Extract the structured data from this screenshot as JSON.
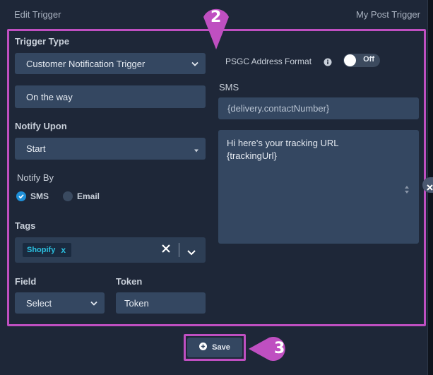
{
  "header": {
    "title": "Edit Trigger",
    "trigger_name": "My Post Trigger"
  },
  "left": {
    "trigger_type_label": "Trigger Type",
    "trigger_type_value": "Customer Notification Trigger",
    "status_value": "On the way",
    "notify_upon_label": "Notify Upon",
    "notify_upon_value": "Start",
    "notify_by_label": "Notify By",
    "notify_by_options": [
      {
        "label": "SMS",
        "selected": true
      },
      {
        "label": "Email",
        "selected": false
      }
    ],
    "tags_label": "Tags",
    "tags": [
      "Shopify"
    ],
    "tag_remove_glyph": "x",
    "tags_clear_glyph": "✕",
    "field_label": "Field",
    "field_value": "Select",
    "token_label": "Token",
    "token_value": "Token"
  },
  "right": {
    "psgc_label": "PSGC Address Format",
    "psgc_toggle": "Off",
    "sms_label": "SMS",
    "sms_recipient": "{delivery.contactNumber}",
    "sms_message_line1": "Hi here's your tracking URL",
    "sms_message_line2": "{trackingUrl}"
  },
  "footer": {
    "save_label": "Save"
  },
  "annotations": {
    "callout_2": "2",
    "callout_3": "3"
  },
  "colors": {
    "dialog_bg": "#1e2738",
    "field_bg": "#344761",
    "highlight": "#bf4fc1",
    "radio_on": "#1e8fd8",
    "tag_text": "#2bc0e0"
  },
  "icons": [
    "chevron-down-icon",
    "info-icon",
    "check-icon",
    "close-icon",
    "plus-circle-icon",
    "resize-handle-icon"
  ]
}
